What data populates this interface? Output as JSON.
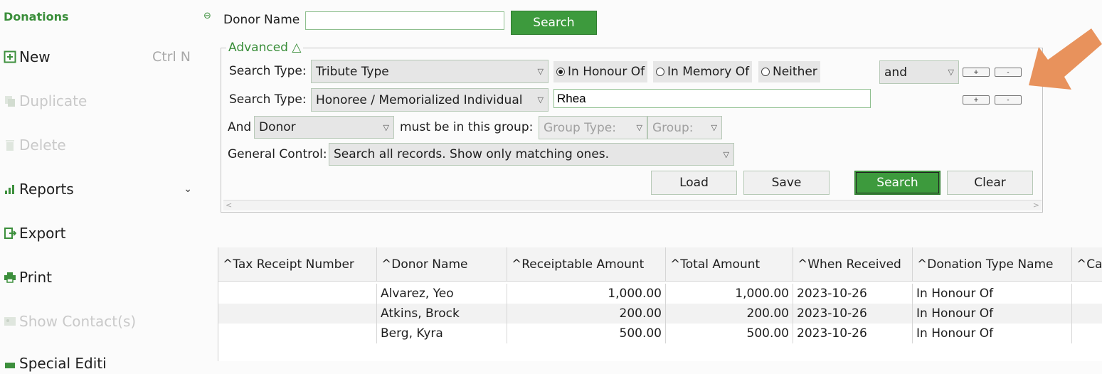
{
  "sidebar": {
    "title": "Donations",
    "items": [
      {
        "label": "New",
        "shortcut": "Ctrl N",
        "icon": "plus-box-icon"
      },
      {
        "label": "Duplicate",
        "icon": "duplicate-icon"
      },
      {
        "label": "Delete",
        "icon": "trash-icon"
      },
      {
        "label": "Reports",
        "icon": "bar-chart-icon"
      },
      {
        "label": "Export",
        "icon": "export-icon"
      },
      {
        "label": "Print",
        "icon": "printer-icon"
      },
      {
        "label": "Show Contact(s)",
        "icon": "contact-card-icon"
      },
      {
        "label": "Special Editi",
        "icon": "edit-icon"
      }
    ]
  },
  "top_search": {
    "label": "Donor Name",
    "value": "",
    "button": "Search"
  },
  "advanced": {
    "legend": "Advanced △",
    "row1": {
      "label": "Search Type:",
      "select": "Tribute Type",
      "radios": [
        "In Honour Of",
        "In Memory Of",
        "Neither"
      ],
      "selected_radio": "In Honour Of",
      "conjunction": "and",
      "plus": "+",
      "minus": "-"
    },
    "row2": {
      "label": "Search Type:",
      "select": "Honoree / Memorialized Individual",
      "value": "Rhea",
      "plus": "+",
      "minus": "-"
    },
    "row3": {
      "prefix": "And",
      "select": "Donor",
      "middle": "must be in this group:",
      "group_type": "Group Type:",
      "group": "Group:"
    },
    "row4": {
      "label": "General Control:",
      "select": "Search all records. Show only matching ones."
    },
    "buttons": {
      "load": "Load",
      "save": "Save",
      "search": "Search",
      "clear": "Clear"
    }
  },
  "table": {
    "columns": [
      "Tax Receipt Number",
      "Donor Name",
      "Receiptable Amount",
      "Total Amount",
      "When Received",
      "Donation Type Name",
      "Ca"
    ],
    "rows": [
      {
        "tax": "",
        "donor": "Alvarez, Yeo",
        "receiptable": "1,000.00",
        "total": "1,000.00",
        "when": "2023-10-26",
        "type": "In Honour Of"
      },
      {
        "tax": "",
        "donor": "Atkins, Brock",
        "receiptable": "200.00",
        "total": "200.00",
        "when": "2023-10-26",
        "type": "In Honour Of"
      },
      {
        "tax": "",
        "donor": "Berg, Kyra",
        "receiptable": "500.00",
        "total": "500.00",
        "when": "2023-10-26",
        "type": "In Honour Of"
      }
    ]
  },
  "colors": {
    "accent": "#3d9a3d",
    "arrow": "#e8925c"
  }
}
